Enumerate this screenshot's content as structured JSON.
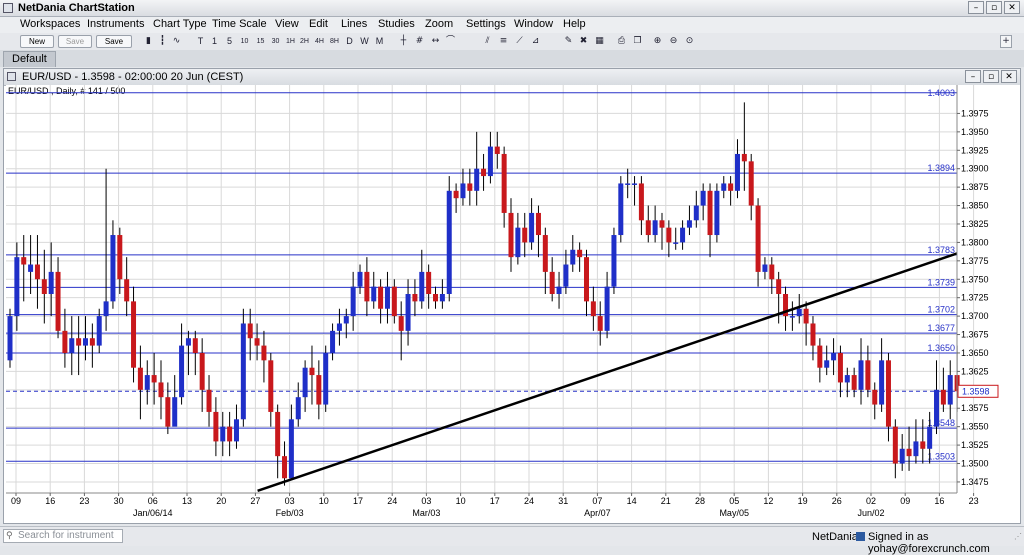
{
  "app": {
    "title": "NetDania ChartStation"
  },
  "menu": [
    "Workspaces",
    "Instruments",
    "Chart Type",
    "Time Scale",
    "View",
    "Edit",
    "Lines",
    "Studies",
    "Zoom",
    "Settings",
    "Window",
    "Help"
  ],
  "toolbar": {
    "new_label": "New",
    "save_label": "Save",
    "saveas_label": "Save as...",
    "icons": [
      "candles",
      "bars",
      "line",
      "T",
      "1",
      "5",
      "10",
      "15",
      "30",
      "1H",
      "2H",
      "4H",
      "8H",
      "D",
      "W",
      "M",
      "crosshair",
      "grid",
      "arrows",
      "period",
      "channel",
      "fib",
      "fan",
      "gann",
      "pen",
      "erase",
      "trash",
      "print",
      "copy",
      "zoom-in",
      "zoom-out",
      "zoom-fit"
    ]
  },
  "tabs": {
    "active": "Default"
  },
  "chart_window": {
    "title": "EUR/USD - 1.3598 - 02:00:00  20 Jun (CEST)",
    "subtitle": "EUR/USD , Daily, # 141 / 500"
  },
  "chart_data": {
    "type": "candlestick",
    "instrument": "EUR/USD",
    "ylim": [
      1.346,
      1.4
    ],
    "y_ticks": [
      "1.3475",
      "1.3500",
      "1.3525",
      "1.3550",
      "1.3575",
      "1.3600",
      "1.3625",
      "1.3650",
      "1.3675",
      "1.3700",
      "1.3725",
      "1.3750",
      "1.3775",
      "1.3800",
      "1.3825",
      "1.3850",
      "1.3875",
      "1.3900",
      "1.3925",
      "1.3950",
      "1.3975"
    ],
    "x_day_labels": [
      "09",
      "16",
      "23",
      "30",
      "06",
      "13",
      "20",
      "27",
      "03",
      "10",
      "17",
      "24",
      "03",
      "10",
      "17",
      "24",
      "31",
      "07",
      "14",
      "21",
      "28",
      "05",
      "12",
      "19",
      "26",
      "02",
      "09",
      "16",
      "23"
    ],
    "x_month_labels": [
      {
        "label": "Jan/06/14",
        "index": 4
      },
      {
        "label": "Feb/03",
        "index": 8
      },
      {
        "label": "Mar/03",
        "index": 12
      },
      {
        "label": "Apr/07",
        "index": 17
      },
      {
        "label": "May/05",
        "index": 21
      },
      {
        "label": "Jun/02",
        "index": 25
      }
    ],
    "horizontal_lines": [
      "1.3894",
      "1.3783",
      "1.3739",
      "1.3702",
      "1.3677",
      "1.3650",
      "1.3548",
      "1.3503"
    ],
    "top_line_label": "1.4003",
    "current_price": "1.3598",
    "current_price_label": "1.3598",
    "trend_line": {
      "from": {
        "label": "Feb/03",
        "price": 1.3463
      },
      "to": {
        "label": "Jun/23",
        "price": 1.3785
      }
    },
    "colors": {
      "up": "#1f2fc8",
      "down": "#c8181c",
      "level": "#2832c8",
      "trend": "#000000",
      "grid": "#d9d9d9"
    },
    "candles": [
      [
        1.364,
        1.37,
        1.363,
        1.371
      ],
      [
        1.37,
        1.378,
        1.368,
        1.38
      ],
      [
        1.378,
        1.377,
        1.372,
        1.381
      ],
      [
        1.376,
        1.377,
        1.373,
        1.381
      ],
      [
        1.377,
        1.375,
        1.371,
        1.381
      ],
      [
        1.375,
        1.373,
        1.369,
        1.379
      ],
      [
        1.373,
        1.376,
        1.37,
        1.38
      ],
      [
        1.376,
        1.368,
        1.367,
        1.378
      ],
      [
        1.368,
        1.365,
        1.363,
        1.371
      ],
      [
        1.365,
        1.367,
        1.362,
        1.37
      ],
      [
        1.367,
        1.366,
        1.362,
        1.37
      ],
      [
        1.366,
        1.367,
        1.364,
        1.37
      ],
      [
        1.367,
        1.366,
        1.363,
        1.369
      ],
      [
        1.366,
        1.37,
        1.365,
        1.371
      ],
      [
        1.37,
        1.372,
        1.368,
        1.39
      ],
      [
        1.372,
        1.381,
        1.371,
        1.383
      ],
      [
        1.381,
        1.375,
        1.373,
        1.382
      ],
      [
        1.375,
        1.372,
        1.37,
        1.378
      ],
      [
        1.372,
        1.363,
        1.361,
        1.374
      ],
      [
        1.363,
        1.36,
        1.356,
        1.366
      ],
      [
        1.36,
        1.362,
        1.358,
        1.364
      ],
      [
        1.362,
        1.361,
        1.358,
        1.365
      ],
      [
        1.361,
        1.359,
        1.356,
        1.364
      ],
      [
        1.359,
        1.355,
        1.354,
        1.361
      ],
      [
        1.355,
        1.359,
        1.356,
        1.362
      ],
      [
        1.359,
        1.366,
        1.358,
        1.369
      ],
      [
        1.366,
        1.367,
        1.362,
        1.368
      ],
      [
        1.367,
        1.365,
        1.362,
        1.368
      ],
      [
        1.365,
        1.36,
        1.357,
        1.367
      ],
      [
        1.36,
        1.357,
        1.355,
        1.362
      ],
      [
        1.357,
        1.353,
        1.351,
        1.359
      ],
      [
        1.353,
        1.355,
        1.351,
        1.357
      ],
      [
        1.355,
        1.353,
        1.351,
        1.357
      ],
      [
        1.353,
        1.356,
        1.352,
        1.358
      ],
      [
        1.356,
        1.369,
        1.355,
        1.371
      ],
      [
        1.369,
        1.367,
        1.364,
        1.371
      ],
      [
        1.367,
        1.366,
        1.364,
        1.369
      ],
      [
        1.366,
        1.364,
        1.361,
        1.368
      ],
      [
        1.364,
        1.357,
        1.355,
        1.365
      ],
      [
        1.357,
        1.351,
        1.348,
        1.358
      ],
      [
        1.351,
        1.348,
        1.347,
        1.353
      ],
      [
        1.348,
        1.356,
        1.348,
        1.358
      ],
      [
        1.356,
        1.359,
        1.355,
        1.361
      ],
      [
        1.359,
        1.363,
        1.357,
        1.364
      ],
      [
        1.363,
        1.362,
        1.358,
        1.366
      ],
      [
        1.362,
        1.358,
        1.356,
        1.364
      ],
      [
        1.358,
        1.365,
        1.357,
        1.366
      ],
      [
        1.365,
        1.368,
        1.364,
        1.369
      ],
      [
        1.368,
        1.369,
        1.366,
        1.371
      ],
      [
        1.369,
        1.37,
        1.367,
        1.371
      ],
      [
        1.37,
        1.374,
        1.368,
        1.376
      ],
      [
        1.374,
        1.376,
        1.373,
        1.377
      ],
      [
        1.376,
        1.372,
        1.37,
        1.378
      ],
      [
        1.372,
        1.374,
        1.371,
        1.376
      ],
      [
        1.374,
        1.371,
        1.369,
        1.375
      ],
      [
        1.371,
        1.374,
        1.369,
        1.376
      ],
      [
        1.374,
        1.37,
        1.369,
        1.375
      ],
      [
        1.37,
        1.368,
        1.364,
        1.372
      ],
      [
        1.368,
        1.373,
        1.366,
        1.375
      ],
      [
        1.373,
        1.372,
        1.37,
        1.375
      ],
      [
        1.372,
        1.376,
        1.371,
        1.379
      ],
      [
        1.376,
        1.373,
        1.371,
        1.377
      ],
      [
        1.373,
        1.372,
        1.371,
        1.374
      ],
      [
        1.372,
        1.373,
        1.371,
        1.375
      ],
      [
        1.373,
        1.387,
        1.372,
        1.389
      ],
      [
        1.387,
        1.386,
        1.384,
        1.388
      ],
      [
        1.386,
        1.388,
        1.385,
        1.39
      ],
      [
        1.388,
        1.387,
        1.385,
        1.39
      ],
      [
        1.387,
        1.39,
        1.385,
        1.395
      ],
      [
        1.39,
        1.389,
        1.387,
        1.392
      ],
      [
        1.389,
        1.393,
        1.388,
        1.395
      ],
      [
        1.393,
        1.392,
        1.39,
        1.395
      ],
      [
        1.392,
        1.384,
        1.382,
        1.393
      ],
      [
        1.384,
        1.378,
        1.376,
        1.386
      ],
      [
        1.378,
        1.382,
        1.377,
        1.384
      ],
      [
        1.382,
        1.38,
        1.378,
        1.384
      ],
      [
        1.38,
        1.384,
        1.379,
        1.386
      ],
      [
        1.384,
        1.381,
        1.378,
        1.385
      ],
      [
        1.381,
        1.376,
        1.373,
        1.382
      ],
      [
        1.376,
        1.373,
        1.372,
        1.378
      ],
      [
        1.373,
        1.374,
        1.371,
        1.376
      ],
      [
        1.374,
        1.377,
        1.373,
        1.379
      ],
      [
        1.377,
        1.379,
        1.376,
        1.381
      ],
      [
        1.379,
        1.378,
        1.376,
        1.38
      ],
      [
        1.378,
        1.372,
        1.37,
        1.379
      ],
      [
        1.372,
        1.37,
        1.368,
        1.374
      ],
      [
        1.37,
        1.368,
        1.366,
        1.372
      ],
      [
        1.368,
        1.374,
        1.367,
        1.376
      ],
      [
        1.374,
        1.381,
        1.373,
        1.382
      ],
      [
        1.381,
        1.388,
        1.38,
        1.389
      ],
      [
        1.388,
        1.388,
        1.386,
        1.39
      ],
      [
        1.388,
        1.388,
        1.385,
        1.389
      ],
      [
        1.388,
        1.383,
        1.381,
        1.389
      ],
      [
        1.383,
        1.381,
        1.38,
        1.385
      ],
      [
        1.381,
        1.383,
        1.38,
        1.385
      ],
      [
        1.383,
        1.382,
        1.379,
        1.384
      ],
      [
        1.382,
        1.38,
        1.378,
        1.383
      ],
      [
        1.38,
        1.38,
        1.379,
        1.382
      ],
      [
        1.38,
        1.382,
        1.379,
        1.383
      ],
      [
        1.382,
        1.383,
        1.381,
        1.385
      ],
      [
        1.383,
        1.385,
        1.382,
        1.387
      ],
      [
        1.385,
        1.387,
        1.383,
        1.388
      ],
      [
        1.387,
        1.381,
        1.378,
        1.388
      ],
      [
        1.381,
        1.387,
        1.38,
        1.388
      ],
      [
        1.387,
        1.388,
        1.386,
        1.389
      ],
      [
        1.388,
        1.387,
        1.385,
        1.389
      ],
      [
        1.387,
        1.392,
        1.386,
        1.394
      ],
      [
        1.392,
        1.391,
        1.387,
        1.399
      ],
      [
        1.391,
        1.385,
        1.383,
        1.392
      ],
      [
        1.385,
        1.376,
        1.374,
        1.386
      ],
      [
        1.376,
        1.377,
        1.375,
        1.378
      ],
      [
        1.377,
        1.375,
        1.373,
        1.378
      ],
      [
        1.375,
        1.373,
        1.369,
        1.376
      ],
      [
        1.373,
        1.37,
        1.368,
        1.374
      ],
      [
        1.37,
        1.37,
        1.368,
        1.372
      ],
      [
        1.37,
        1.371,
        1.369,
        1.373
      ],
      [
        1.371,
        1.369,
        1.366,
        1.372
      ],
      [
        1.369,
        1.366,
        1.364,
        1.37
      ],
      [
        1.366,
        1.363,
        1.361,
        1.367
      ],
      [
        1.363,
        1.364,
        1.362,
        1.366
      ],
      [
        1.364,
        1.365,
        1.362,
        1.367
      ],
      [
        1.365,
        1.361,
        1.359,
        1.366
      ],
      [
        1.361,
        1.362,
        1.359,
        1.363
      ],
      [
        1.362,
        1.36,
        1.359,
        1.363
      ],
      [
        1.36,
        1.364,
        1.358,
        1.367
      ],
      [
        1.364,
        1.36,
        1.359,
        1.366
      ],
      [
        1.36,
        1.358,
        1.356,
        1.361
      ],
      [
        1.358,
        1.364,
        1.357,
        1.367
      ],
      [
        1.364,
        1.355,
        1.353,
        1.365
      ],
      [
        1.355,
        1.35,
        1.348,
        1.356
      ],
      [
        1.35,
        1.352,
        1.349,
        1.354
      ],
      [
        1.352,
        1.351,
        1.349,
        1.355
      ],
      [
        1.351,
        1.353,
        1.35,
        1.356
      ],
      [
        1.353,
        1.352,
        1.35,
        1.356
      ],
      [
        1.352,
        1.355,
        1.35,
        1.357
      ],
      [
        1.355,
        1.36,
        1.354,
        1.364
      ],
      [
        1.36,
        1.358,
        1.357,
        1.363
      ],
      [
        1.358,
        1.362,
        1.356,
        1.364
      ],
      [
        1.362,
        1.3598,
        1.357,
        1.366
      ]
    ]
  },
  "status": {
    "search_placeholder": "Search for instrument",
    "brand": "NetDania",
    "user_text": "Signed in as yohay@forexcrunch.com"
  }
}
